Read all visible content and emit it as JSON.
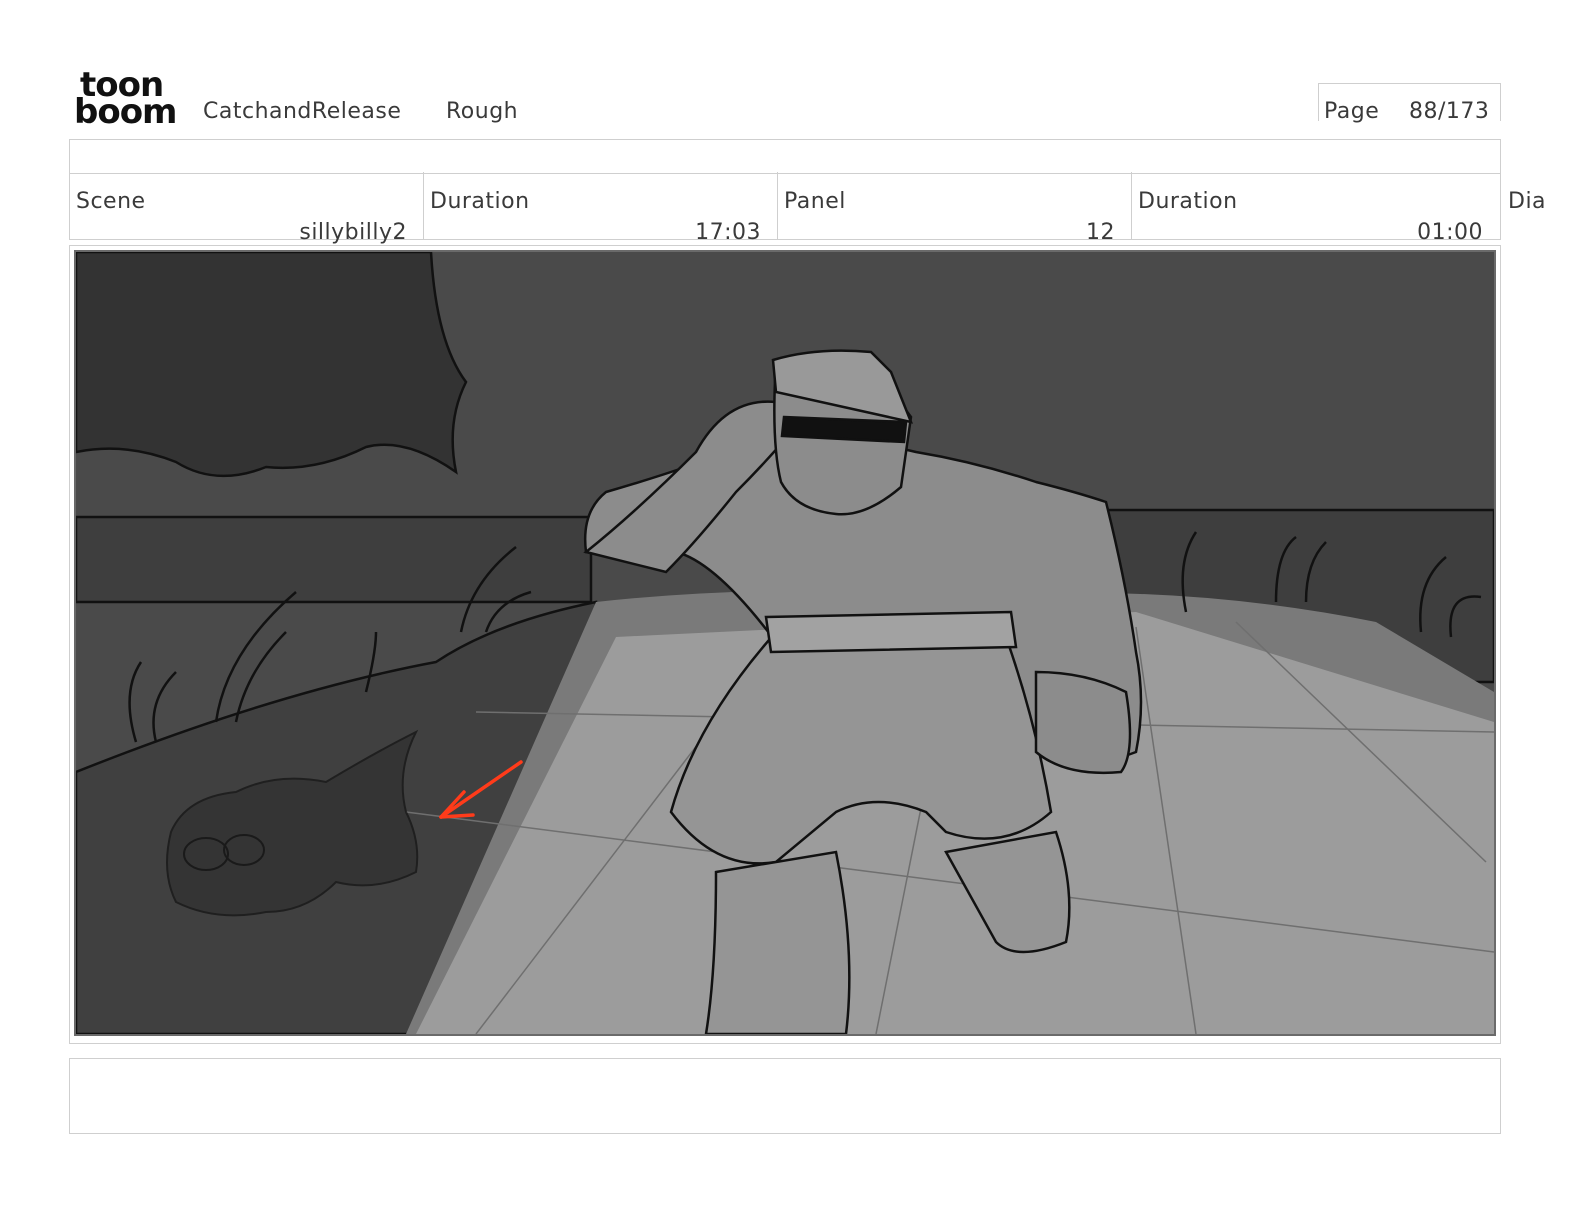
{
  "header": {
    "logo_line1": "toon",
    "logo_line2": "boom",
    "project": "CatchandRelease",
    "stage": "Rough",
    "page_label": "Page",
    "page_value": "88/173"
  },
  "info": {
    "scene_label": "Scene",
    "scene_value": "sillybilly2",
    "scene_duration_label": "Duration",
    "scene_duration_value": "17:03",
    "panel_label": "Panel",
    "panel_value": "12",
    "panel_duration_label": "Duration",
    "panel_duration_value": "01:00",
    "dialogue_label": "Dia"
  },
  "colors": {
    "sky": "#4a4a4a",
    "dark_ground": "#3c3c3c",
    "spotlight": "#9a9a9a",
    "figure": "#8e8e8e",
    "arrow": "#ff3b1a"
  }
}
